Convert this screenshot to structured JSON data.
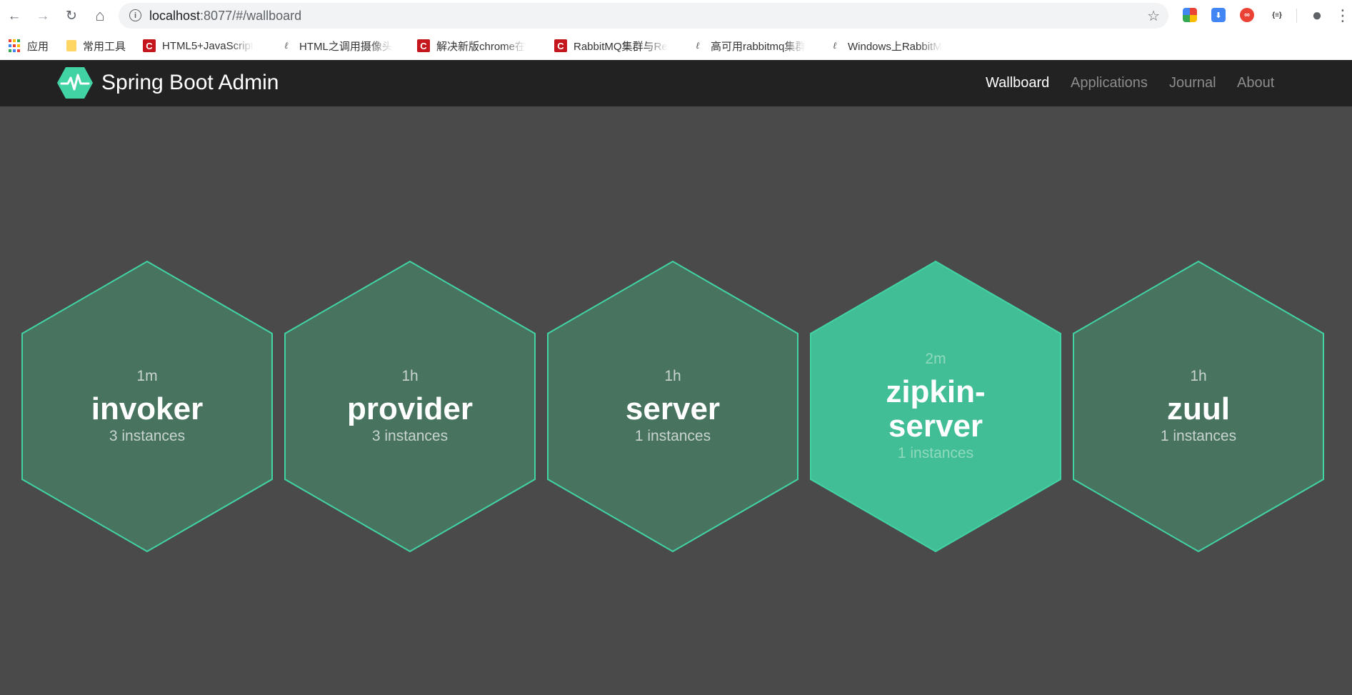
{
  "browser": {
    "back_glyph": "←",
    "forward_glyph": "→",
    "reload_glyph": "↻",
    "home_glyph": "⌂",
    "info_glyph": "i",
    "url_host": "localhost",
    "url_rest": ":8077/#/wallboard",
    "star_glyph": "☆",
    "profile_glyph": "●",
    "menu_glyph": "⋮",
    "extensions": [
      {
        "name": "colorful-extension-icon",
        "label": "",
        "color": "#fbbc04"
      },
      {
        "name": "download-extension-icon",
        "label": "⬇",
        "color": "#4285f4"
      },
      {
        "name": "infinity-extension-icon",
        "label": "∞",
        "color": "#ea4335"
      },
      {
        "name": "json-extension-icon",
        "label": "{≡}",
        "color": "#ffffff"
      }
    ],
    "bookmarks": [
      {
        "label": "应用",
        "icon": "apps-icon"
      },
      {
        "label": "常用工具",
        "icon": "folder-icon"
      },
      {
        "label": "HTML5+JavaScript",
        "icon": "csdn-icon"
      },
      {
        "label": "HTML之调用摄像头",
        "icon": "link-icon"
      },
      {
        "label": "解决新版chrome在",
        "icon": "csdn-icon"
      },
      {
        "label": "RabbitMQ集群与Re",
        "icon": "csdn-icon"
      },
      {
        "label": "高可用rabbitmq集群",
        "icon": "link-icon"
      },
      {
        "label": "Windows上RabbitM",
        "icon": "link-icon"
      }
    ]
  },
  "header": {
    "brand": "Spring Boot Admin",
    "nav": [
      {
        "label": "Wallboard",
        "active": true
      },
      {
        "label": "Applications",
        "active": false
      },
      {
        "label": "Journal",
        "active": false
      },
      {
        "label": "About",
        "active": false
      }
    ]
  },
  "colors": {
    "hex_fill_default": "#47735f",
    "hex_fill_up": "#42be96",
    "hex_stroke": "#42d3a5",
    "appbar": "#222222",
    "page_bg": "#4a4a4a"
  },
  "applications": [
    {
      "uptime": "1m",
      "name_lines": [
        "invoker"
      ],
      "instances": "3 instances",
      "status": "default"
    },
    {
      "uptime": "1h",
      "name_lines": [
        "provider"
      ],
      "instances": "3 instances",
      "status": "default"
    },
    {
      "uptime": "1h",
      "name_lines": [
        "server"
      ],
      "instances": "1 instances",
      "status": "default"
    },
    {
      "uptime": "2m",
      "name_lines": [
        "zipkin-",
        "server"
      ],
      "instances": "1 instances",
      "status": "up"
    },
    {
      "uptime": "1h",
      "name_lines": [
        "zuul"
      ],
      "instances": "1 instances",
      "status": "default"
    }
  ]
}
